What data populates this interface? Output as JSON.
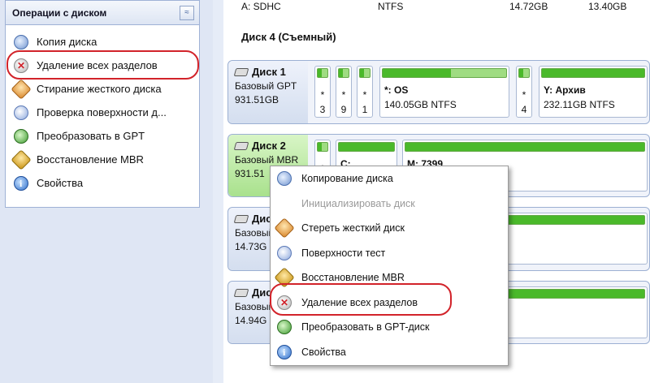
{
  "operations_panel": {
    "title": "Операции с диском",
    "collapse_glyph": "≈",
    "items": [
      {
        "label": "Копия диска",
        "icon": "disk-copy-icon"
      },
      {
        "label": "Удаление всех разделов",
        "icon": "delete-partitions-icon"
      },
      {
        "label": "Стирание жесткого диска",
        "icon": "wipe-disk-icon"
      },
      {
        "label": "Проверка поверхности д...",
        "icon": "surface-test-icon"
      },
      {
        "label": "Преобразовать в GPT",
        "icon": "convert-gpt-icon"
      },
      {
        "label": "Восстановление MBR",
        "icon": "rebuild-mbr-icon"
      },
      {
        "label": "Свойства",
        "icon": "properties-icon"
      }
    ]
  },
  "top_row": {
    "name": "A: SDHC",
    "fs": "NTFS",
    "capacity": "14.72GB",
    "used": "13.40GB"
  },
  "section_title": "Диск 4 (Съемный)",
  "disks": [
    {
      "name": "Диск 1",
      "type": "Базовый GPT",
      "size": "931.51GB",
      "partitions": [
        {
          "char": "*",
          "num": "3"
        },
        {
          "char": "*",
          "num": "9"
        },
        {
          "char": "*",
          "num": "1"
        },
        {
          "label": "*: OS",
          "info": "140.05GB NTFS",
          "fill": 0.55
        },
        {
          "char": "*",
          "num": "4"
        },
        {
          "label": "Y: Архив",
          "info": "232.11GB NTFS",
          "fill": 1.0
        }
      ]
    },
    {
      "name": "Диск 2",
      "type": "Базовый MBR",
      "size": "931.51",
      "partitions": [
        {
          "char": "*"
        },
        {
          "label": "C:"
        },
        {
          "label": "M: 7399"
        }
      ]
    },
    {
      "name": "Диск 3",
      "type": "Базовый",
      "size": "14.73G"
    },
    {
      "name": "Диск 5",
      "type": "Базовый",
      "size": "14.94G"
    }
  ],
  "context_menu": {
    "items": [
      {
        "label": "Копирование диска",
        "enabled": true
      },
      {
        "label": "Инициализировать диск",
        "enabled": false
      },
      {
        "label": "Стереть жесткий диск",
        "enabled": true
      },
      {
        "label": "Поверхности тест",
        "enabled": true
      },
      {
        "label": "Восстановление MBR",
        "enabled": true
      },
      {
        "label": "Удаление всех разделов",
        "enabled": true
      },
      {
        "label": "Преобразовать в GPT-диск",
        "enabled": true
      },
      {
        "label": "Свойства",
        "enabled": true
      }
    ]
  },
  "colors": {
    "accent_red": "#d2232a",
    "partition_green": "#4ab92a",
    "selected_disk": "#a9e18d"
  }
}
